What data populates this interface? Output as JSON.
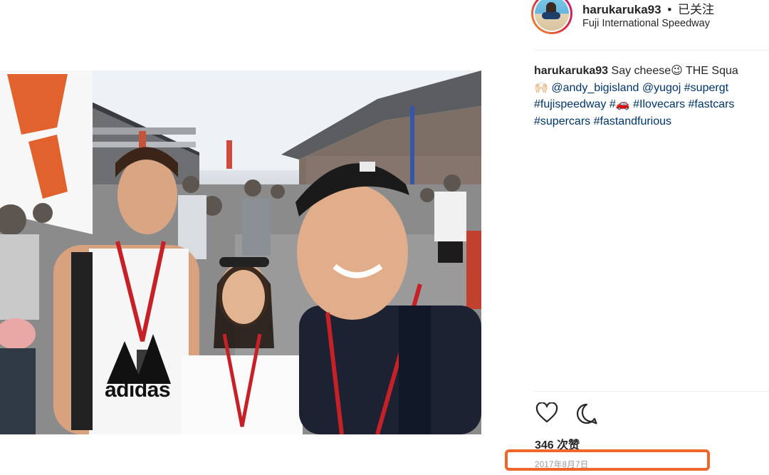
{
  "post": {
    "username": "harukaruka93",
    "separator": "•",
    "follow_state": "已关注",
    "location": "Fuji International Speedway"
  },
  "caption": {
    "username": "harukaruka93",
    "text_line1": "Say cheese😉 THE Squa",
    "line2_emoji": "🙌🏻",
    "mention1": "@andy_bigisland",
    "mention2": "@yugoj",
    "tag_supergt": "#supergt",
    "tag_fujispeedway": "#fujispeedway",
    "tag_car": "#🚗",
    "tag_ilovecars": "#Ilovecars",
    "tag_fastcars": "#fastcars",
    "tag_supercars": "#supercars",
    "tag_fastandfurious": "#fastandfurious"
  },
  "actions": {
    "like_icon": "heart-icon",
    "comment_icon": "comment-bubble-icon"
  },
  "stats": {
    "likes": "346 次赞",
    "date": "2017年8月7日"
  },
  "photo": {
    "shirt_text": "adidas",
    "description_icon": "selfie-photo"
  },
  "colors": {
    "link": "#003569",
    "highlight_box": "#f0652a",
    "muted_text": "#999999"
  }
}
